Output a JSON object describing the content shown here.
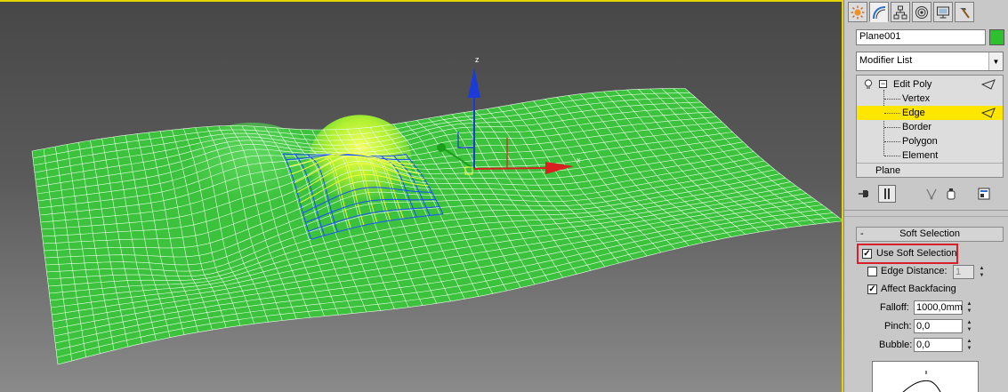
{
  "viewport": {
    "gizmo_z_label": "z",
    "gizmo_x_label": "x",
    "colors": {
      "mesh_fill": "#3cc23c",
      "mesh_wire": "#e8ffe8",
      "selection_wire": "#1a4fff",
      "selected_core": "#f0ff40",
      "active_border": "#e6d400"
    }
  },
  "command_panel": {
    "tabs": [
      {
        "name": "create-tab",
        "icon": "sun-icon"
      },
      {
        "name": "modify-tab",
        "icon": "modify-curve-icon"
      },
      {
        "name": "hierarchy-tab",
        "icon": "hierarchy-icon"
      },
      {
        "name": "motion-tab",
        "icon": "motion-circle-icon"
      },
      {
        "name": "display-tab",
        "icon": "monitor-icon"
      },
      {
        "name": "utilities-tab",
        "icon": "hammer-icon"
      }
    ],
    "object_name": "Plane001",
    "object_color": "#2fc02f",
    "modifier_list_label": "Modifier List",
    "stack": {
      "edit_poly": "Edit Poly",
      "sub_objects": [
        "Vertex",
        "Edge",
        "Border",
        "Polygon",
        "Element"
      ],
      "selected_sub_object": "Edge",
      "base_object": "Plane"
    }
  },
  "soft_selection": {
    "title": "Soft Selection",
    "collapse_symbol": "-",
    "use_soft_selection": "Use Soft Selection",
    "use_soft_selection_checked": true,
    "edge_distance_label": "Edge Distance:",
    "edge_distance_value": "1",
    "edge_distance_checked": false,
    "affect_backfacing_label": "Affect Backfacing",
    "affect_backfacing_checked": true,
    "falloff_label": "Falloff:",
    "falloff_value": "1000,0mm",
    "pinch_label": "Pinch:",
    "pinch_value": "0,0",
    "bubble_label": "Bubble:",
    "bubble_value": "0,0"
  }
}
